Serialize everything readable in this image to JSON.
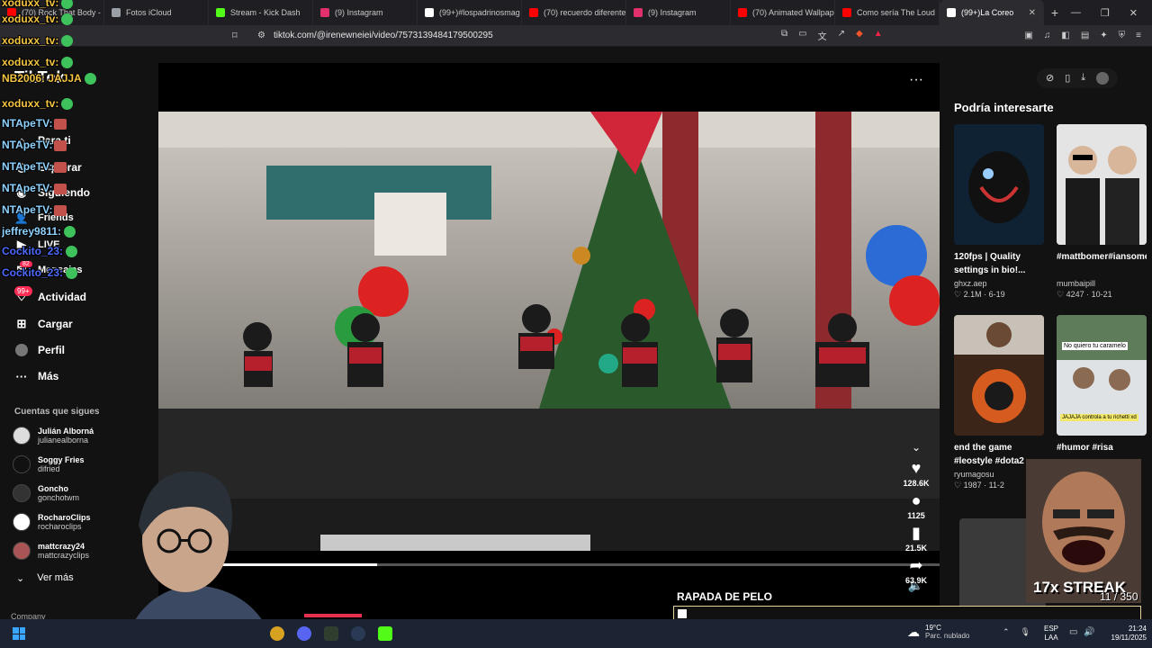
{
  "browser": {
    "tabs": [
      {
        "title": "(70) Rock That Body -",
        "fav": "#ff0000"
      },
      {
        "title": "Fotos iCloud",
        "fav": "#9aa0a6"
      },
      {
        "title": "Stream - Kick Dash",
        "fav": "#53fc18"
      },
      {
        "title": "(9) Instagram",
        "fav": "#e1306c"
      },
      {
        "title": "(99+)#lospadrinosmag",
        "fav": "#ffffff"
      },
      {
        "title": "(70) recuerdo diferente",
        "fav": "#ff0000"
      },
      {
        "title": "(9) Instagram",
        "fav": "#e1306c"
      },
      {
        "title": "(70) Animated Wallpap",
        "fav": "#ff0000"
      },
      {
        "title": "Como sería The Loud",
        "fav": "#ff0000"
      },
      {
        "title": "(99+)La Coreo",
        "fav": "#ffffff",
        "active": true
      }
    ],
    "url": "tiktok.com/@irenewneiei/video/7573139484179500295"
  },
  "sidebar": {
    "logo": "TikTok",
    "items": [
      {
        "label": "Para ti",
        "icon": "home-icon"
      },
      {
        "label": "Explorar",
        "icon": "compass-icon"
      },
      {
        "label": "Siguiendo",
        "icon": "following-icon"
      },
      {
        "label": "Friends",
        "icon": "friends-icon"
      },
      {
        "label": "LIVE",
        "icon": "live-icon"
      },
      {
        "label": "Mensajes",
        "icon": "message-icon"
      },
      {
        "label": "Actividad",
        "icon": "activity-icon"
      },
      {
        "label": "Cargar",
        "icon": "upload-icon"
      },
      {
        "label": "Perfil",
        "icon": "profile-icon"
      },
      {
        "label": "Más",
        "icon": "more-icon"
      }
    ],
    "activity_badge": "99+",
    "messages_badge": "82",
    "following_header": "Cuentas que sigues",
    "following": [
      {
        "name": "Julián Alborná",
        "handle": "julianealborna"
      },
      {
        "name": "Soggy Fries",
        "handle": "difried"
      },
      {
        "name": "Goncho",
        "handle": "gonchotwm"
      },
      {
        "name": "RocharoClips",
        "handle": "rocharoclips"
      },
      {
        "name": "mattcrazy24",
        "handle": "mattcrazyclips"
      }
    ],
    "see_more": "Ver más",
    "company": "Company"
  },
  "video": {
    "more_icon": "more-icon",
    "progress_fraction": 0.28,
    "likes": "128.6K",
    "comments": "1125",
    "saves": "21.5K",
    "shares": "63.9K"
  },
  "recommended": {
    "title": "Podría interesarte",
    "cards": [
      {
        "title": "120fps | Quality settings in bio!...",
        "user": "ghxz.aep",
        "meta": "♡ 2.1M · 6-19"
      },
      {
        "title": "#mattbomer#iansomerholder...",
        "user": "mumbaipill",
        "meta": "♡ 4247 · 10-21"
      },
      {
        "title": "end the game #leostyle #dota2",
        "user": "ryumagosu",
        "meta": "♡ 1987 · 11-2"
      },
      {
        "title": "#humor #risa",
        "user": "",
        "meta": ""
      }
    ],
    "card4_caption": "No quiero tu caramelo",
    "card4_sub": "JAJAJA controla a tu richetti xd"
  },
  "chat": [
    {
      "user": "xoduxx_tv:",
      "color": "#f5c542"
    },
    {
      "user": "xoduxx_tv:",
      "color": "#f5c542"
    },
    {
      "user": "xoduxx_tv:",
      "color": "#f5c542"
    },
    {
      "user": "xoduxx_tv:",
      "color": "#f5c542"
    },
    {
      "user": "NB2006: JAJJA",
      "color": "#f5c542"
    },
    {
      "user": "xoduxx_tv:",
      "color": "#f5c542"
    },
    {
      "user": "NTApeTV:",
      "color": "#8fd3ff"
    },
    {
      "user": "NTApeTV:",
      "color": "#8fd3ff"
    },
    {
      "user": "NTApeTV:",
      "color": "#8fd3ff"
    },
    {
      "user": "NTApeTV:",
      "color": "#8fd3ff"
    },
    {
      "user": "NTApeTV:",
      "color": "#8fd3ff"
    },
    {
      "user": "jeffrey9811:",
      "color": "#8fd3ff"
    },
    {
      "user": "Cockito_23:",
      "color": "#4b6bff"
    },
    {
      "user": "Cockito_23:",
      "color": "#4b6bff"
    }
  ],
  "overlay": {
    "streak": "17x STREAK",
    "counter_a": "11",
    "counter_b": "350",
    "rapada": "RAPADA DE PELO"
  },
  "taskbar": {
    "temp": "19°C",
    "weather": "Parc. nublado",
    "lang1": "ESP",
    "lang2": "LAA",
    "time": "21:24",
    "date": "19/11/2025"
  }
}
